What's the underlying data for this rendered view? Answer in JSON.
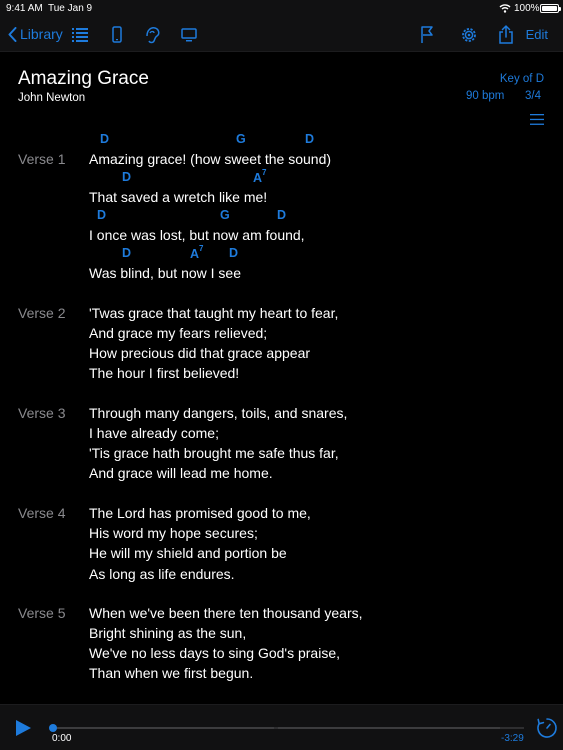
{
  "status": {
    "time": "9:41 AM",
    "date": "Tue Jan 9",
    "battery": "100%"
  },
  "nav": {
    "back_label": "Library",
    "edit_label": "Edit",
    "icons": [
      "list-icon",
      "phone-icon",
      "tune-icon",
      "monitor-icon",
      "flag-icon",
      "gear-icon",
      "share-icon"
    ]
  },
  "song": {
    "title": "Amazing Grace",
    "author": "John Newton",
    "key": "Key of D",
    "bpm": "90 bpm",
    "meter": "3/4"
  },
  "verses": [
    {
      "label": "Verse 1",
      "lines": [
        {
          "text": "Amazing grace! (how sweet the sound)",
          "chords": [
            {
              "chord": "D",
              "sup": ""
            },
            {
              "chord": "G",
              "sup": ""
            },
            {
              "chord": "D",
              "sup": ""
            }
          ]
        },
        {
          "text": "That saved a wretch like me!",
          "chords": [
            {
              "chord": "D",
              "sup": ""
            },
            {
              "chord": "A",
              "sup": "7"
            }
          ]
        },
        {
          "text": "I once was lost, but now am found,",
          "chords": [
            {
              "chord": "D",
              "sup": ""
            },
            {
              "chord": "G",
              "sup": ""
            },
            {
              "chord": "D",
              "sup": ""
            }
          ]
        },
        {
          "text": "Was blind, but now I see",
          "chords": [
            {
              "chord": "D",
              "sup": ""
            },
            {
              "chord": "A",
              "sup": "7"
            },
            {
              "chord": "D",
              "sup": ""
            }
          ]
        }
      ]
    },
    {
      "label": "Verse 2",
      "lines": [
        {
          "text": "'Twas grace that taught my heart to fear,"
        },
        {
          "text": "And grace my fears relieved;"
        },
        {
          "text": "How precious did that grace appear"
        },
        {
          "text": "The hour I first believed!"
        }
      ]
    },
    {
      "label": "Verse 3",
      "lines": [
        {
          "text": "Through many dangers, toils, and snares,"
        },
        {
          "text": "I have already come;"
        },
        {
          "text": "'Tis grace hath brought me safe thus far,"
        },
        {
          "text": "And grace will lead me home."
        }
      ]
    },
    {
      "label": "Verse 4",
      "lines": [
        {
          "text": "The Lord has promised good to me,"
        },
        {
          "text": "His word my hope secures;"
        },
        {
          "text": "He will my shield and portion be"
        },
        {
          "text": "As long as life endures."
        }
      ]
    },
    {
      "label": "Verse 5",
      "lines": [
        {
          "text": "When we've been there ten thousand years,"
        },
        {
          "text": "Bright shining as the sun,"
        },
        {
          "text": "We've no less days to sing God's praise,"
        },
        {
          "text": "Than when we first begun."
        }
      ]
    }
  ],
  "player": {
    "elapsed": "0:00",
    "remaining": "-3:29",
    "progress": 0
  },
  "colors": {
    "accent": "#1e7bdc",
    "background": "#000000",
    "bar": "#111112",
    "label": "#8a8a8e"
  }
}
